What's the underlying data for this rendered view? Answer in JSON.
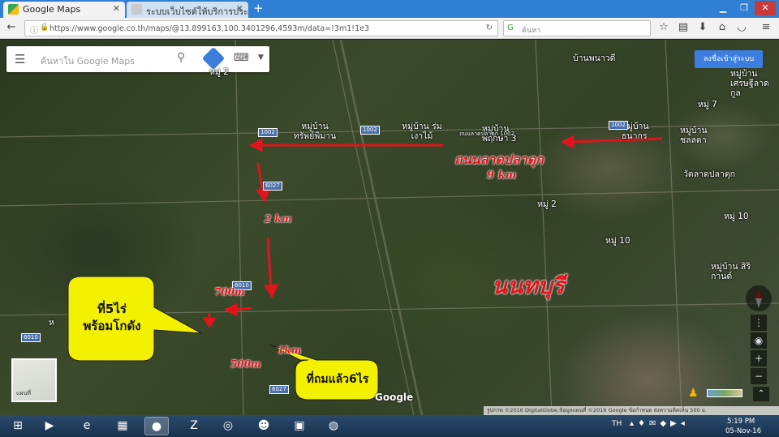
{
  "browser": {
    "tabs": [
      {
        "title": "Google Maps",
        "active": true
      },
      {
        "title": "ระบบเว็บไซต์ให้บริการประชาชน : ...",
        "active": false
      }
    ],
    "url": "https://www.google.co.th/maps/@13.899163,100.3401296,4593m/data=!3m1!1e3",
    "search_placeholder": "ค้นหา"
  },
  "maps": {
    "search_placeholder": "ค้นหาใน Google Maps",
    "signin_label": "ลงชื่อเข้าสู่ระบบ",
    "labels": {
      "village_top_left": "หมู่ 2",
      "village_sap": "หมู่บ้าน ทรัพย์พิมาน",
      "village_rom": "หมู่บ้าน ร่มเงาไม้",
      "village_moo3": "หมู่บ้าน พฤกษา 3",
      "village_top_center": "บ้านพนาวดี",
      "village_thanakorn": "หมู่บ้าน ธนากร",
      "moo7": "หมู่ 7",
      "village_chonlada": "หมู่บ้าน ชลลดา",
      "village_serilat": "หมู่บ้าน เศรษฐีลาดกูล",
      "wat_latpladuk": "วัดลาดปลาดุก",
      "moo2_center": "หมู่ 2",
      "moo10": "หมู่ 10",
      "moo10b": "หมู่ 10",
      "village_sirikan": "หมู่บ้าน สิริกานต์",
      "road_top_center": "ถนนลาดปลาดุก 1002",
      "moo_left": "ห"
    },
    "road_shields": [
      "1002",
      "1002",
      "6027",
      "6010",
      "6027",
      "6010",
      "1002"
    ],
    "annotations": {
      "road_name": "ถนนลาดปลาดุก",
      "road_distance": "9 km",
      "dist_2km": "2 km",
      "dist_700m": "700m",
      "dist_1km": "1km",
      "dist_500m": "500m",
      "province": "นนทบุรี"
    },
    "callouts": {
      "plot_5rai": "ที่5ไร่\nพร้อมโกดัง",
      "plot_6rai": "ที่ถมแล้ว6ไร"
    },
    "satellite_thumb_label": "แผนที่",
    "google_logo": "Google",
    "attribution": "รูปภาพ ©2016 DigitalGlobe,ข้อมูลแผนที่ ©2016 Google   ข้อกำหนด   ส่งความคิดเห็น   500 ม."
  },
  "taskbar": {
    "lang": "TH",
    "time": "5:19 PM",
    "date": "05-Nov-16"
  },
  "colors": {
    "annotation_red": "#e0141c",
    "callout_yellow": "#f3f000",
    "browser_blue": "#2f7fd4",
    "maps_blue": "#3b7de0"
  }
}
